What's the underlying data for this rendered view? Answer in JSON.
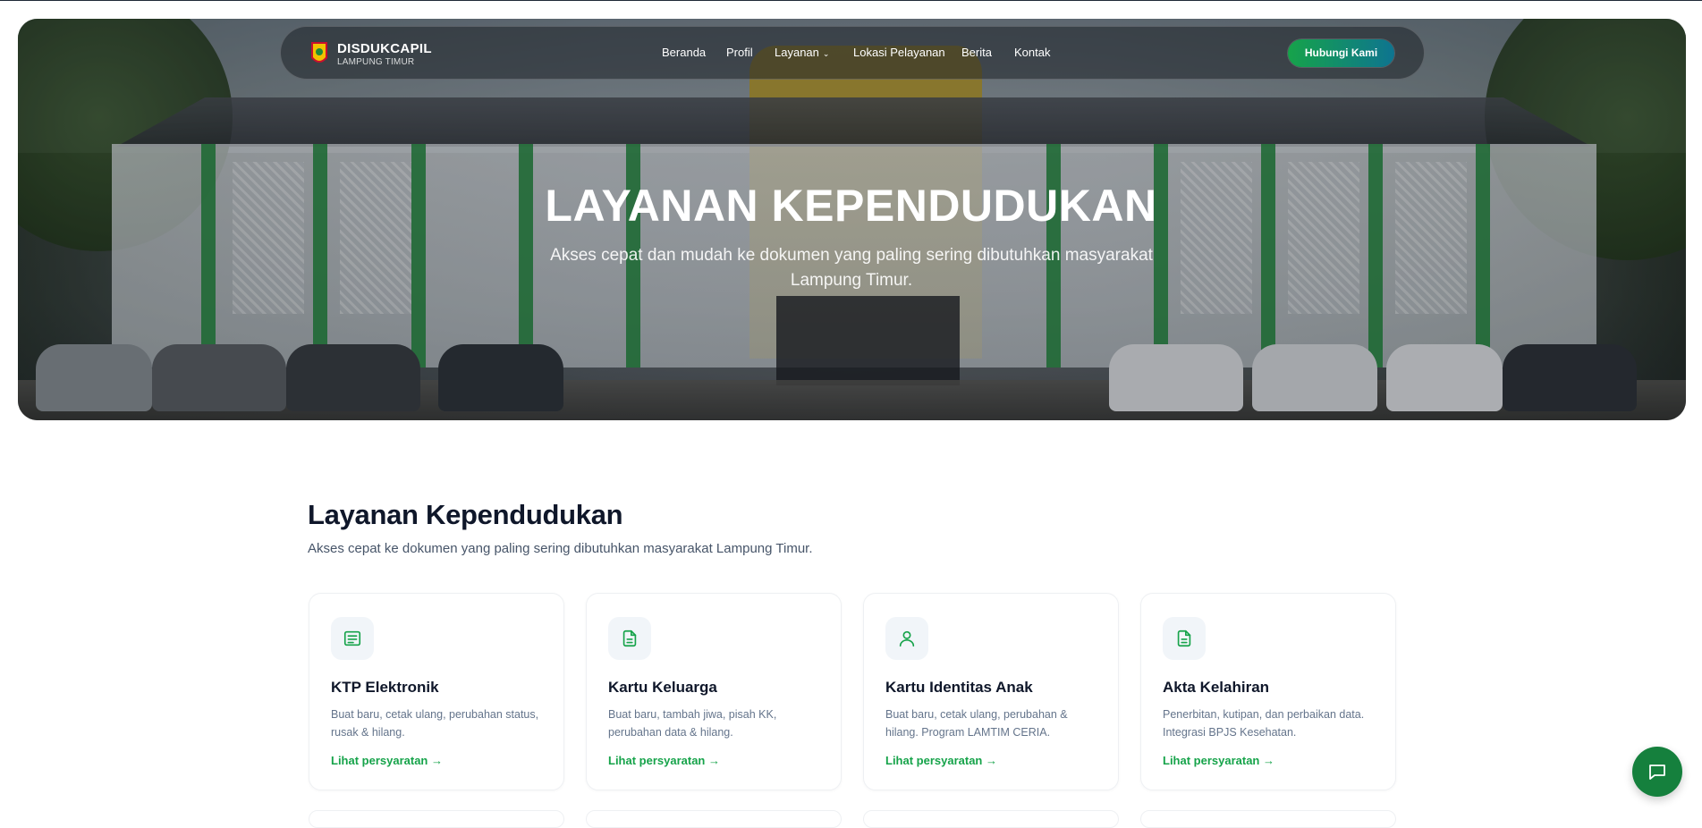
{
  "nav": {
    "brand_title": "DISDUKCAPIL",
    "brand_sub": "LAMPUNG TIMUR",
    "links": [
      "Beranda",
      "Profil",
      "Layanan",
      "Lokasi Pelayanan",
      "Berita",
      "Kontak"
    ],
    "cta": "Hubungi Kami"
  },
  "hero": {
    "title": "LAYANAN KEPENDUDUKAN",
    "subtitle": "Akses cepat dan mudah ke dokumen yang paling sering dibutuhkan masyarakat Lampung Timur."
  },
  "section": {
    "title": "Layanan Kependudukan",
    "subtitle": "Akses cepat ke dokumen yang paling sering dibutuhkan masyarakat Lampung Timur."
  },
  "cards": [
    {
      "icon": "id-card-icon",
      "title": "KTP Elektronik",
      "desc": "Buat baru, cetak ulang, perubahan status, rusak & hilang.",
      "link": "Lihat persyaratan"
    },
    {
      "icon": "document-icon",
      "title": "Kartu Keluarga",
      "desc": "Buat baru, tambah jiwa, pisah KK, perubahan data & hilang.",
      "link": "Lihat persyaratan"
    },
    {
      "icon": "user-icon",
      "title": "Kartu Identitas Anak",
      "desc": "Buat baru, cetak ulang, perubahan & hilang. Program LAMTIM CERIA.",
      "link": "Lihat persyaratan"
    },
    {
      "icon": "document-icon",
      "title": "Akta Kelahiran",
      "desc": "Penerbitan, kutipan, dan perbaikan data. Integrasi BPJS Kesehatan.",
      "link": "Lihat persyaratan"
    }
  ],
  "colors": {
    "accent": "#16a34a",
    "cta_start": "#16a34a",
    "cta_end": "#0e7490",
    "fab": "#15803d"
  },
  "fab_icon": "chat-icon"
}
